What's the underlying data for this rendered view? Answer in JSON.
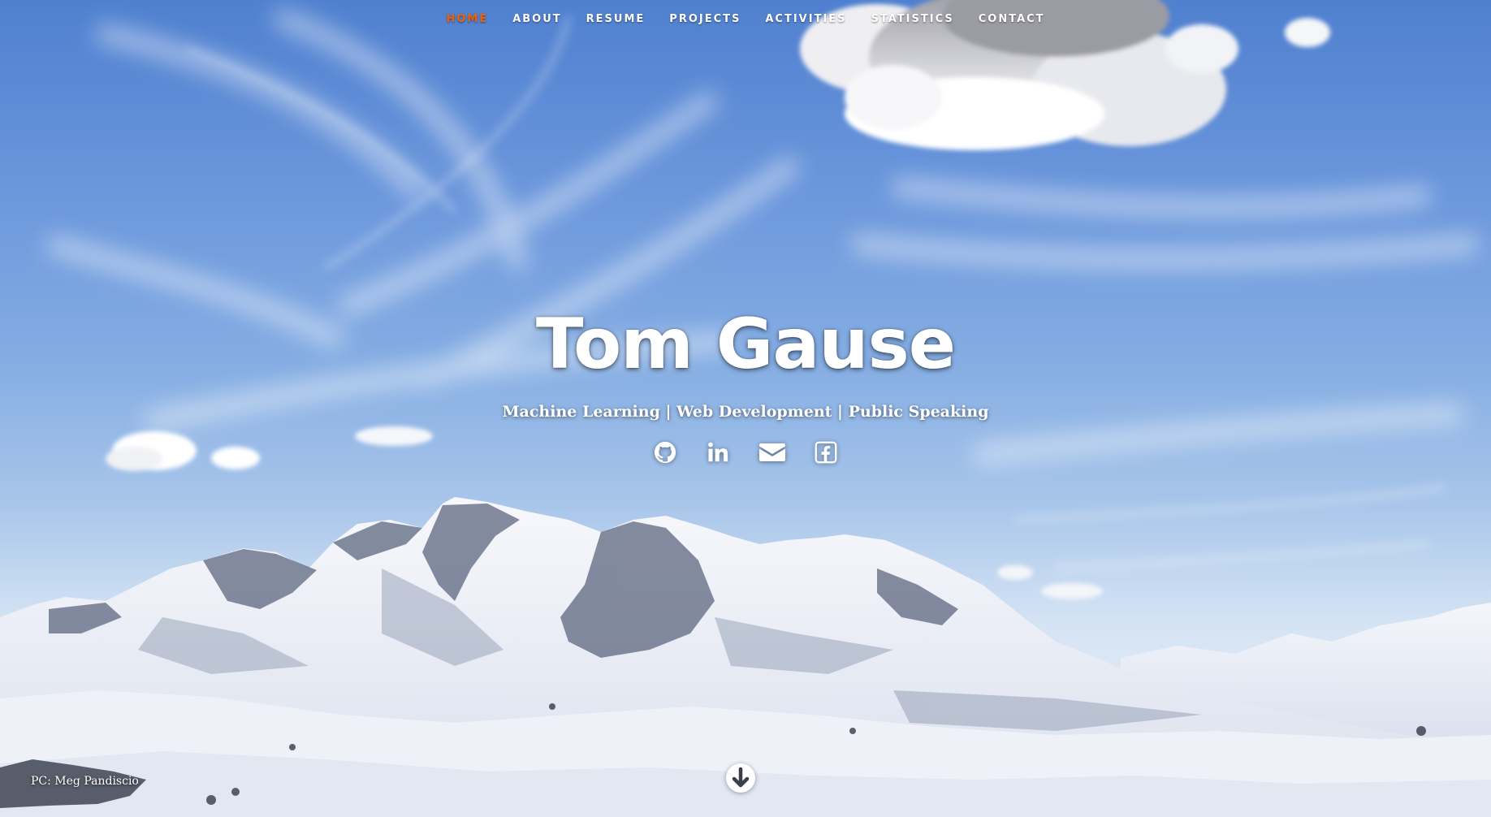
{
  "nav": {
    "items": [
      {
        "label": "HOME",
        "active": true
      },
      {
        "label": "ABOUT",
        "active": false
      },
      {
        "label": "RESUME",
        "active": false
      },
      {
        "label": "PROJECTS",
        "active": false
      },
      {
        "label": "ACTIVITIES",
        "active": false
      },
      {
        "label": "STATISTICS",
        "active": false
      },
      {
        "label": "CONTACT",
        "active": false
      }
    ],
    "active_color": "#f06000"
  },
  "hero": {
    "name": "Tom Gause",
    "tagline": "Machine Learning | Web Development | Public Speaking",
    "social_icons": [
      "github-icon",
      "linkedin-icon",
      "envelope-icon",
      "facebook-icon"
    ],
    "photo_credit": "PC: Meg Pandiscio",
    "scroll_icon": "arrow-circle-down-icon"
  }
}
